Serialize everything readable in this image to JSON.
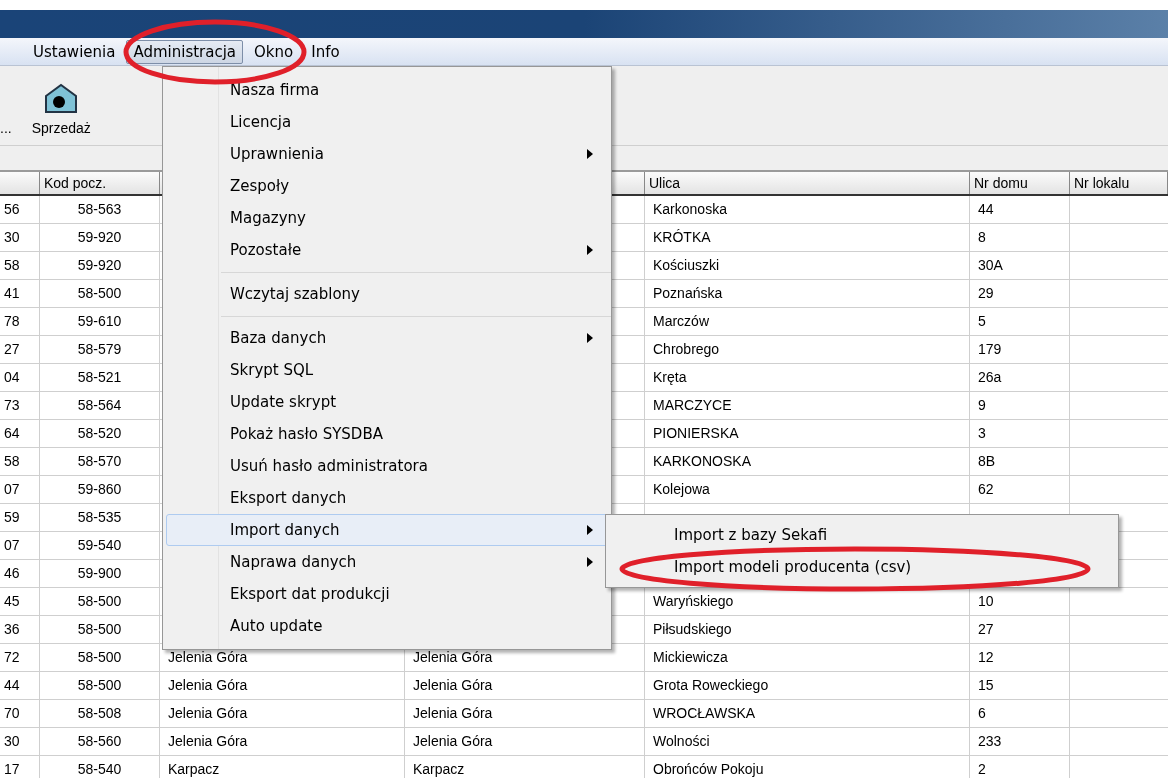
{
  "menu_bar": [
    {
      "label": "Ustawienia",
      "selected": false
    },
    {
      "label": "Administracja",
      "selected": true
    },
    {
      "label": "Okno",
      "selected": false
    },
    {
      "label": "Info",
      "selected": false
    }
  ],
  "toolbar": [
    {
      "label": "...",
      "kind": "text"
    },
    {
      "label": "Sprzedaż",
      "kind": "house"
    }
  ],
  "table": {
    "columns": [
      "",
      "Kod pocz.",
      "",
      "",
      "Ulica",
      "Nr domu",
      "Nr lokalu"
    ],
    "rows": [
      {
        "column_1": "56",
        "kod": "58-563",
        "ulica": "Karkonoska",
        "nr_domu": "44"
      },
      {
        "column_1": "30",
        "kod": "59-920",
        "ulica": "KRÓTKA",
        "nr_domu": "8"
      },
      {
        "column_1": "58",
        "kod": "59-920",
        "ulica": "Kościuszki",
        "nr_domu": "30A"
      },
      {
        "column_1": "41",
        "kod": "58-500",
        "ulica": "Poznańska",
        "nr_domu": "29"
      },
      {
        "column_1": "78",
        "kod": "59-610",
        "ulica": "Marczów",
        "nr_domu": "5"
      },
      {
        "column_1": "27",
        "kod": "58-579",
        "ulica": "Chrobrego",
        "nr_domu": "179"
      },
      {
        "column_1": "04",
        "kod": "58-521",
        "ulica": "Kręta",
        "nr_domu": "26a"
      },
      {
        "column_1": "73",
        "kod": "58-564",
        "ulica": "MARCZYCE",
        "nr_domu": "9"
      },
      {
        "column_1": "64",
        "kod": "58-520",
        "ulica": "PIONIERSKA",
        "nr_domu": "3"
      },
      {
        "column_1": "58",
        "kod": "58-570",
        "ulica": "KARKONOSKA",
        "nr_domu": "8B"
      },
      {
        "column_1": "07",
        "kod": "59-860",
        "ulica": "Kolejowa",
        "nr_domu": "62"
      },
      {
        "column_1": "59",
        "kod": "58-535"
      },
      {
        "column_1": "07",
        "kod": "59-540"
      },
      {
        "column_1": "46",
        "kod": "59-900"
      },
      {
        "column_1": "45",
        "kod": "58-500",
        "ulica": "Waryńskiego",
        "nr_domu": "10"
      },
      {
        "column_1": "36",
        "kod": "58-500",
        "ulica": "Piłsudskiego",
        "nr_domu": "27"
      },
      {
        "column_1": "72",
        "kod": "58-500",
        "column_3": "Jelenia Góra",
        "column_4": "Jelenia Góra",
        "ulica": "Mickiewicza",
        "nr_domu": "12"
      },
      {
        "column_1": "44",
        "kod": "58-500",
        "column_3": "Jelenia Góra",
        "column_4": "Jelenia Góra",
        "ulica": "Grota Roweckiego",
        "nr_domu": "15"
      },
      {
        "column_1": "70",
        "kod": "58-508",
        "column_3": "Jelenia Góra",
        "column_4": "Jelenia Góra",
        "ulica": "WROCŁAWSKA",
        "nr_domu": "6"
      },
      {
        "column_1": "30",
        "kod": "58-560",
        "column_3": "Jelenia Góra",
        "column_4": "Jelenia Góra",
        "ulica": "Wolności",
        "nr_domu": "233"
      },
      {
        "column_1": "17",
        "kod": "58-540",
        "column_3": "Karpacz",
        "column_4": "Karpacz",
        "ulica": "Obrońców  Pokoju",
        "nr_domu": "2"
      }
    ]
  },
  "menu": {
    "items": [
      {
        "kind": "item",
        "label": "Nasza firma",
        "submenu": false,
        "selected": false
      },
      {
        "kind": "item",
        "label": "Licencja",
        "submenu": false,
        "selected": false
      },
      {
        "kind": "item",
        "label": "Uprawnienia",
        "submenu": true,
        "selected": false
      },
      {
        "kind": "item",
        "label": "Zespoły",
        "submenu": false,
        "selected": false
      },
      {
        "kind": "item",
        "label": "Magazyny",
        "submenu": false,
        "selected": false
      },
      {
        "kind": "item",
        "label": "Pozostałe",
        "submenu": true,
        "selected": false
      },
      {
        "kind": "separator"
      },
      {
        "kind": "item",
        "label": "Wczytaj szablony",
        "submenu": false,
        "selected": false
      },
      {
        "kind": "separator"
      },
      {
        "kind": "item",
        "label": "Baza danych",
        "submenu": true,
        "selected": false
      },
      {
        "kind": "item",
        "label": "Skrypt SQL",
        "submenu": false,
        "selected": false
      },
      {
        "kind": "item",
        "label": "Update skrypt",
        "submenu": false,
        "selected": false
      },
      {
        "kind": "item",
        "label": "Pokaż hasło SYSDBA",
        "submenu": false,
        "selected": false
      },
      {
        "kind": "item",
        "label": "Usuń hasło administratora",
        "submenu": false,
        "selected": false
      },
      {
        "kind": "item",
        "label": "Eksport danych",
        "submenu": false,
        "selected": false
      },
      {
        "kind": "item",
        "label": "Import danych",
        "submenu": true,
        "selected": true
      },
      {
        "kind": "item",
        "label": "Naprawa danych",
        "submenu": true,
        "selected": false
      },
      {
        "kind": "item",
        "label": "Eksport dat produkcji",
        "submenu": false,
        "selected": false
      },
      {
        "kind": "item",
        "label": "Auto update",
        "submenu": false,
        "selected": false
      }
    ]
  },
  "submenu": {
    "items": [
      {
        "label": "Import z bazy Sekafi",
        "selected": false
      },
      {
        "label": "Import modeli producenta (csv)",
        "selected": false
      }
    ]
  }
}
